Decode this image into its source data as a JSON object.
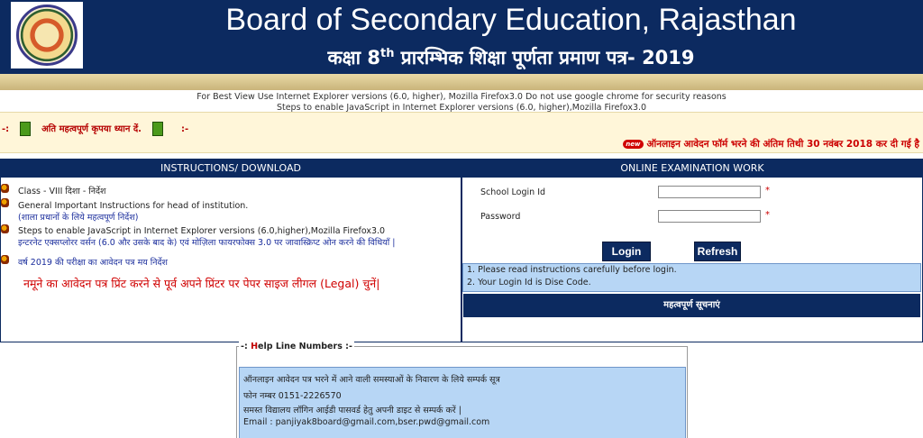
{
  "header": {
    "title_en": "Board of Secondary Education, Rajasthan",
    "title_hi_prefix": "कक्षा 8",
    "title_hi_sup": "th",
    "title_hi_suffix": " प्रारम्भिक शिक्षा पूर्णता प्रमाण पत्र- 2019"
  },
  "notices": {
    "line1": "For Best View Use Internet Explorer versions (6.0, higher), Mozilla Firefox3.0 Do not use google chrome for security reasons",
    "line2": "Steps to enable JavaScript in Internet Explorer versions (6.0, higher),Mozilla Firefox3.0"
  },
  "alert": {
    "prefix": "-:",
    "title": "अति महत्वपूर्ण कृपया ध्यान दें.",
    "suffix": ":-",
    "badge": "new",
    "marquee": "ऑनलाइन आवेदन फॉर्म भरने की अंतिम तिथी 30 नवंबर 2018 कर दी गई है"
  },
  "instructions": {
    "header": "INSTRUCTIONS/ DOWNLOAD",
    "item1": "Class - VIII दिशा - निर्देश",
    "item2_en": "General Important Instructions for head of institution.",
    "item2_hi": "(शाला प्रधानों के लिये महत्वपूर्ण निर्देश)",
    "item3_en": "Steps to enable JavaScript in Internet Explorer versions (6.0,higher),Mozilla Firefox3.0",
    "item3_hi": "इन्टरनेट एक्सप्लोरर वर्सन (6.0 और उसके बाद के) एवं मोज़िला फायरफोक्स 3.0 पर जावास्क्रिप्ट ओन करने की विधियाँ |",
    "item4": "वर्ष 2019 की परीक्षा का आवेदन पत्र मय निर्देश",
    "big_red": "नमूने का आवेदन पत्र प्रिंट करने से पूर्व अपने प्रिंटर पर पेपर साइज लीगल (Legal) चुनें|"
  },
  "exam": {
    "header": "ONLINE EXAMINATION WORK",
    "login_label": "School Login Id",
    "password_label": "Password",
    "required_mark": "*",
    "login_value": "",
    "password_value": "",
    "login_button": "Login",
    "refresh_button": "Refresh",
    "info1": "1. Please read instructions carefully before login.",
    "info2": "2. Your Login Id is Dise Code.",
    "notices_button": "महत्वपूर्ण सूचनाएं"
  },
  "help": {
    "legend_prefix": "-: ",
    "legend_first": "H",
    "legend_rest": "elp Line Numbers :-",
    "line1": "ऑनलाइन आवेदन पत्र भरने में आने वाली समस्याओं के निवारण के लिये सम्पर्क सूत्र",
    "line2": "फोन नम्बर   0151-2226570",
    "line3": "समस्त विद्यालय लॉगिन आईडी पासवर्ड हेतु अपनी डाइट से सम्पर्क करें |",
    "line4": "Email : panjiyak8board@gmail.com,bser.pwd@gmail.com"
  },
  "colors": {
    "navy": "#0c2a60",
    "gold": "#c9b47a",
    "alert_red": "#cc0000",
    "light_blue": "#b7d6f5"
  }
}
